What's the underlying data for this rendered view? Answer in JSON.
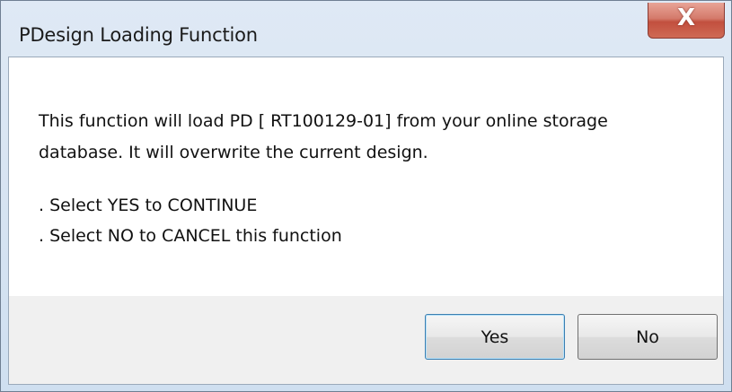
{
  "window": {
    "title": "PDesign Loading Function",
    "close_symbol": "X"
  },
  "message": {
    "line1": "This function will load PD [ RT100129-01] from your online storage",
    "line2": "database. It will overwrite the current design.",
    "line3": ". Select YES to CONTINUE",
    "line4": ". Select NO to CANCEL this function"
  },
  "buttons": {
    "yes_label": "Yes",
    "no_label": "No"
  },
  "icons": {
    "close": "close-icon"
  }
}
